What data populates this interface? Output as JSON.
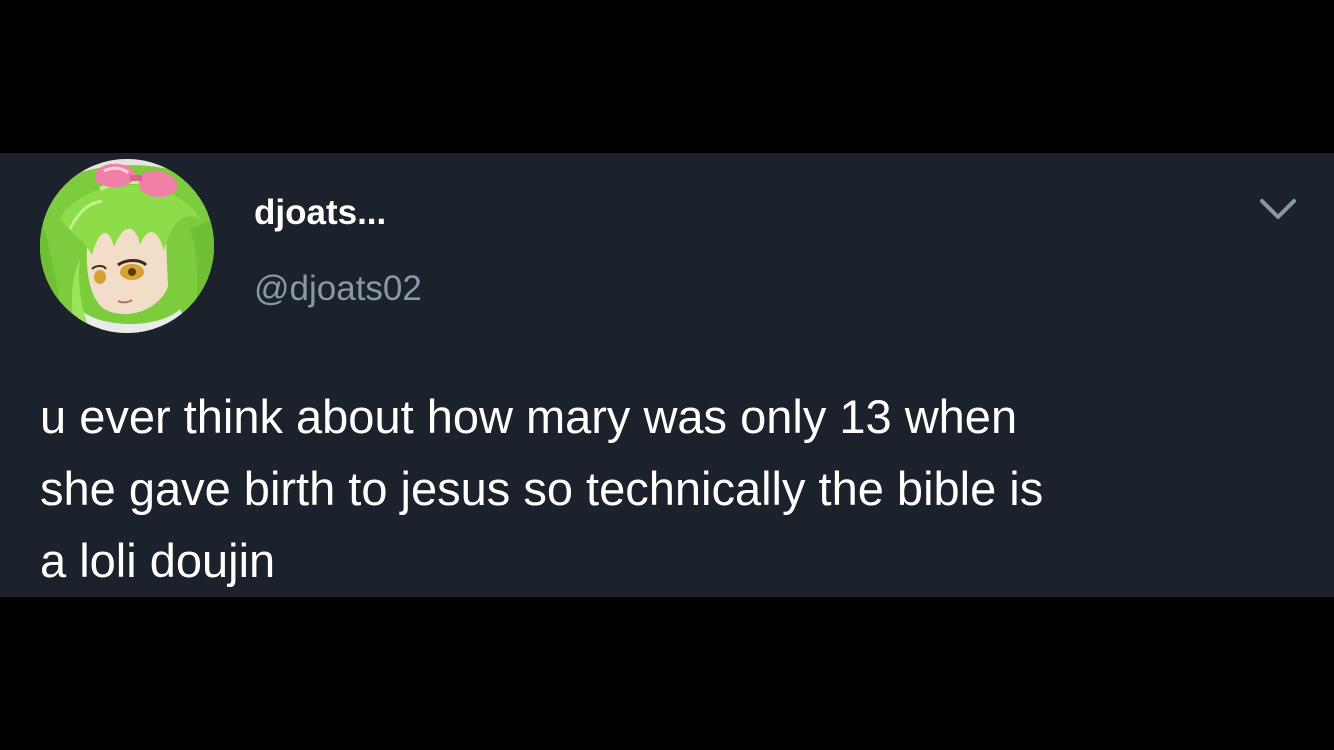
{
  "tweet": {
    "author": {
      "display_name": "djoats...",
      "handle": "@djoats02",
      "avatar_icon": "anime-avatar-green-hair"
    },
    "menu_icon": "chevron-down-icon",
    "text": "u ever think about how mary was only 13 when\nshe gave birth to jesus so technically the bible is\na loli doujin"
  },
  "colors": {
    "page_background": "#000000",
    "card_background": "#1b222c",
    "primary_text": "#ffffff",
    "secondary_text": "#8899a6"
  }
}
